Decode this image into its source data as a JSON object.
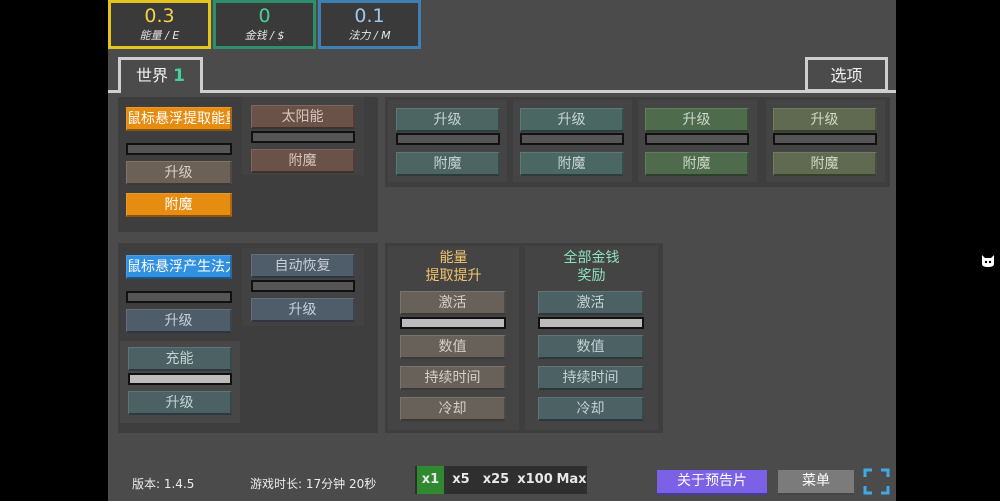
{
  "resources": [
    {
      "value": "0.3",
      "label": "能量 / E"
    },
    {
      "value": "0",
      "label": "金钱 / $"
    },
    {
      "value": "0.1",
      "label": "法力 / M"
    }
  ],
  "tabs": {
    "world_label": "世界",
    "world_number": "1",
    "options_label": "选项"
  },
  "energy_panel": {
    "hover_button": "鼠标悬浮提取能量",
    "upgrade": "升级",
    "enchant": "附魔",
    "solar": "太阳能",
    "solar_enchant": "附魔"
  },
  "generators": [
    {
      "upgrade": "升级",
      "enchant": "附魔"
    },
    {
      "upgrade": "升级",
      "enchant": "附魔"
    },
    {
      "upgrade": "升级",
      "enchant": "附魔"
    },
    {
      "upgrade": "升级",
      "enchant": "附魔"
    }
  ],
  "mana_panel": {
    "hover_button": "鼠标悬浮产生法力",
    "upgrade": "升级",
    "auto_restore": "自动恢复",
    "auto_upgrade": "升级",
    "charge": "充能",
    "charge_upgrade": "升级"
  },
  "boosts": [
    {
      "title_line1": "能量",
      "title_line2": "提取提升",
      "activate": "激活",
      "value": "数值",
      "duration": "持续时间",
      "cooldown": "冷却"
    },
    {
      "title_line1": "全部金钱",
      "title_line2": "奖励",
      "activate": "激活",
      "value": "数值",
      "duration": "持续时间",
      "cooldown": "冷却"
    }
  ],
  "footer": {
    "version": "版本: 1.4.5",
    "playtime": "游戏时长: 17分钟 20秒",
    "multipliers": [
      "x1",
      "x5",
      "x25",
      "x100",
      "Max"
    ],
    "selected_multiplier": "x1",
    "trailer": "关于预告片",
    "menu": "菜单"
  },
  "colors": {
    "energy": "#e4c51e",
    "money": "#2e8f6c",
    "mana": "#3f7fb4",
    "accent_green": "#46d19c"
  }
}
